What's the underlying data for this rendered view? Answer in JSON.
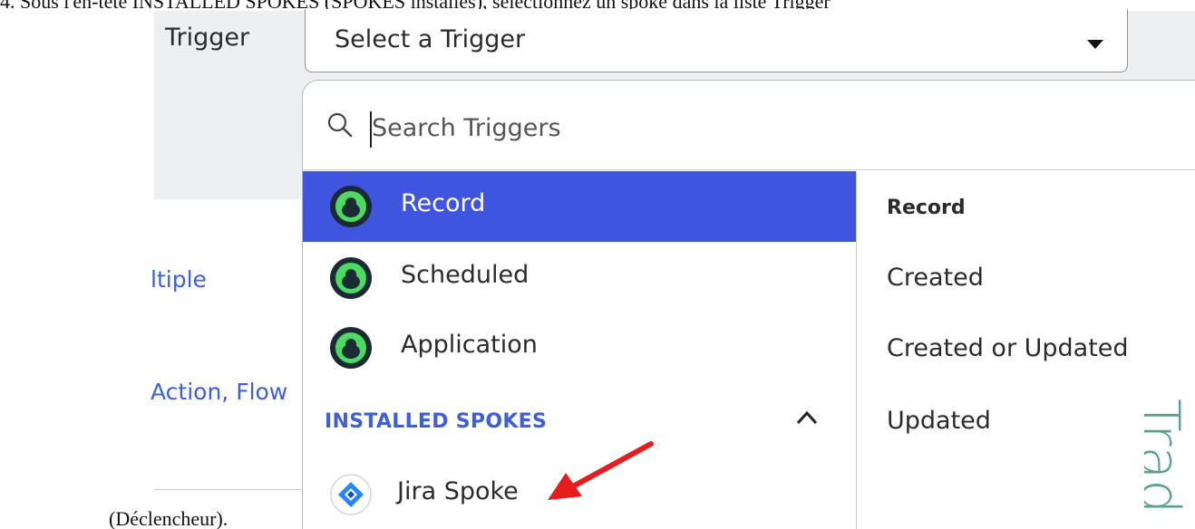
{
  "doc": {
    "caption_top": "4. Sous l'en-tête INSTALLED SPOKES (SPOKES installés), sélectionnez un spoke dans la liste Trigger",
    "caption_bottom": "(Déclencheur)."
  },
  "form": {
    "trigger_label": "Trigger",
    "trigger_select_value": "Select a Trigger"
  },
  "background_links": {
    "multiple": "ltiple",
    "action": "Action, Flow"
  },
  "dropdown": {
    "search_placeholder": "Search Triggers",
    "items": [
      {
        "label": "Record",
        "icon": "trigger-type-icon",
        "selected": true
      },
      {
        "label": "Scheduled",
        "icon": "trigger-type-icon",
        "selected": false
      },
      {
        "label": "Application",
        "icon": "trigger-type-icon",
        "selected": false
      }
    ],
    "installed_spokes_header": "INSTALLED SPOKES",
    "spokes": [
      {
        "label": "Jira Spoke",
        "icon": "jira-icon"
      }
    ],
    "detail": {
      "heading": "Record",
      "options": [
        "Created",
        "Created or Updated",
        "Updated"
      ]
    }
  },
  "watermark": "Trad",
  "colors": {
    "accent_blue": "#3f55e0",
    "link_blue": "#3e5fd6",
    "icon_green": "#4cd964",
    "icon_dark": "#1a2b33",
    "annotation_red": "#e81c1c",
    "watermark_green": "#5aa08a"
  }
}
